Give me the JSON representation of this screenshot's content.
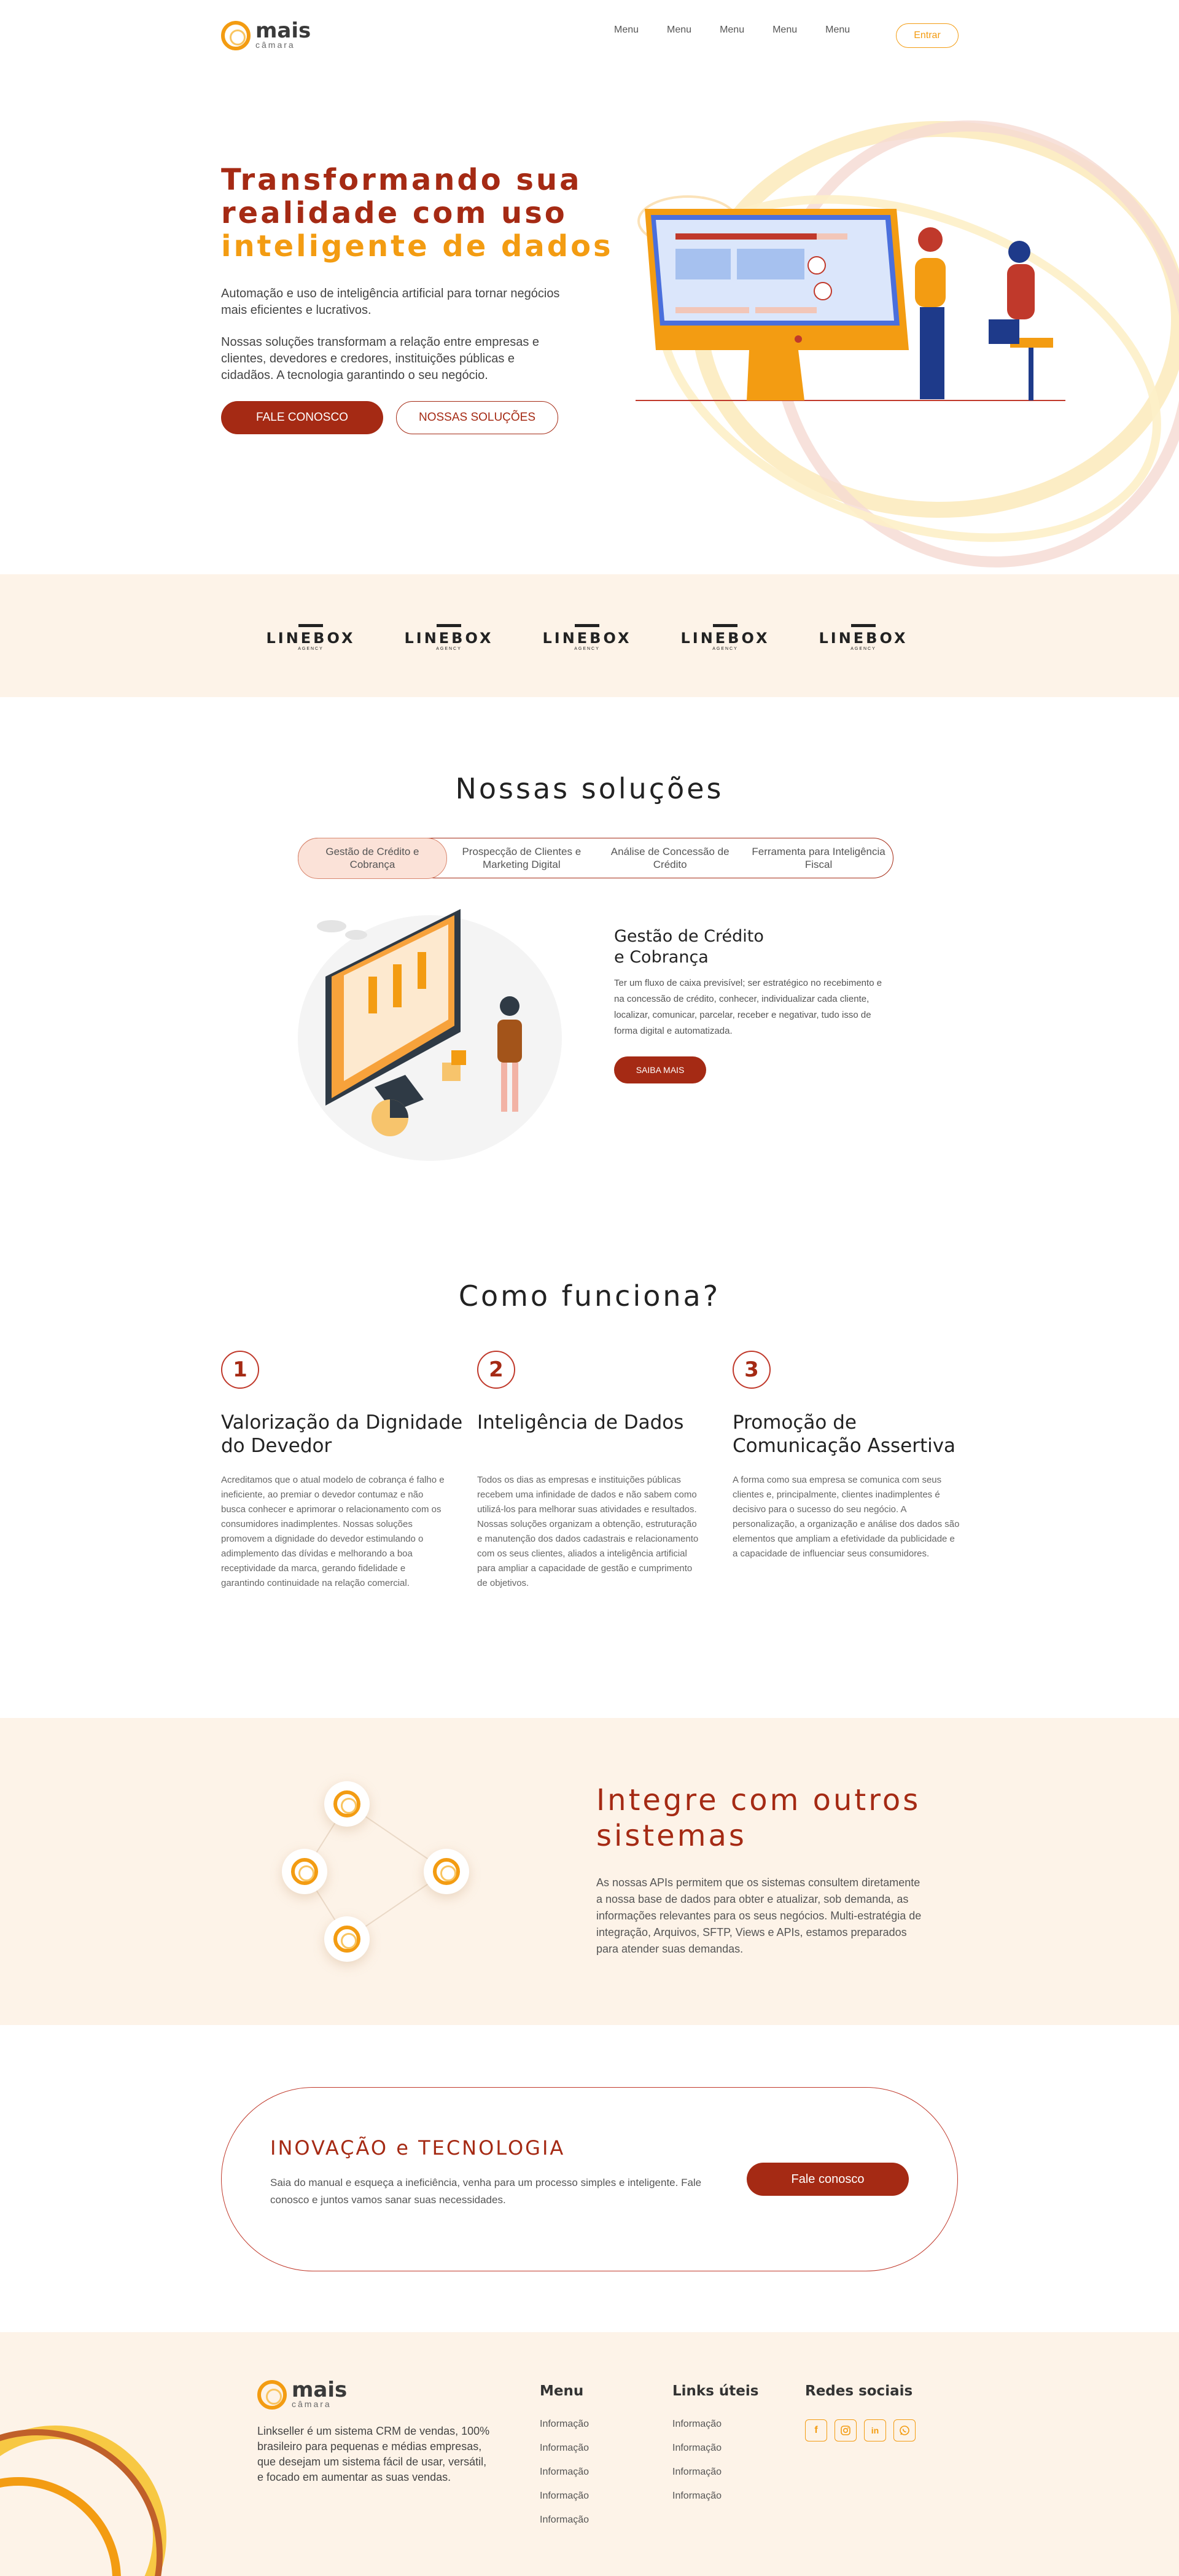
{
  "header": {
    "logo": {
      "brand": "mais",
      "sub": "câmara"
    },
    "nav": [
      "Menu",
      "Menu",
      "Menu",
      "Menu",
      "Menu"
    ],
    "login_label": "Entrar"
  },
  "hero": {
    "title_line1": "Transformando sua",
    "title_line2": "realidade com uso",
    "title_accent": "inteligente de dados",
    "paragraph1": "Automação e uso de inteligência artificial para tornar negócios mais eficientes e lucrativos.",
    "paragraph2": "Nossas soluções transformam a relação entre empresas e clientes, devedores e credores, instituições públicas e cidadãos. A tecnologia garantindo o seu negócio.",
    "primary_label": "FALE CONOSCO",
    "secondary_label": "NOSSAS SOLUÇÕES"
  },
  "partners": [
    {
      "name": "LINEBOX",
      "sub": "AGENCY"
    },
    {
      "name": "LINEBOX",
      "sub": "AGENCY"
    },
    {
      "name": "LINEBOX",
      "sub": "AGENCY"
    },
    {
      "name": "LINEBOX",
      "sub": "AGENCY"
    },
    {
      "name": "LINEBOX",
      "sub": "AGENCY"
    }
  ],
  "solutions": {
    "title": "Nossas soluções",
    "tabs": [
      "Gestão de Crédito e Cobrança",
      "Prospecção de Clientes e Marketing Digital",
      "Análise de Concessão de Crédito",
      "Ferramenta para Inteligência Fiscal"
    ],
    "active_title_line1": "Gestão de Crédito",
    "active_title_line2": "e Cobrança",
    "active_desc": "Ter um fluxo de caixa previsível; ser estratégico no recebimento e na concessão de crédito, conhecer, individualizar cada cliente, localizar, comunicar, parcelar, receber e negativar, tudo isso de forma digital e automatizada.",
    "button_label": "SAIBA MAIS"
  },
  "how": {
    "title": "Como funciona?",
    "steps": [
      {
        "number": "1",
        "title_line1": "Valorização da Dignidade",
        "title_line2": "do Devedor",
        "desc": "Acreditamos que o atual modelo de cobrança é falho e ineficiente, ao premiar o devedor contumaz e não busca conhecer e aprimorar o relacionamento com os consumidores inadimplentes. Nossas soluções promovem a dignidade do devedor estimulando o adimplemento das dívidas e melhorando a boa receptividade da marca, gerando fidelidade e garantindo continuidade na relação comercial."
      },
      {
        "number": "2",
        "title_line1": "Inteligência de Dados",
        "title_line2": "",
        "desc": "Todos os dias as empresas e instituições públicas recebem uma infinidade de dados e não sabem como utilizá-los para melhorar suas atividades e resultados. Nossas soluções organizam a obtenção, estruturação e manutenção dos dados cadastrais e relacionamento com os seus clientes, aliados a inteligência artificial para ampliar a capacidade de gestão e cumprimento de objetivos."
      },
      {
        "number": "3",
        "title_line1": "Promoção de",
        "title_line2": "Comunicação Assertiva",
        "desc": "A forma como sua empresa se comunica com seus clientes e, principalmente, clientes inadimplentes é decisivo para o sucesso do seu negócio. A personalização, a organização e análise dos dados são elementos que ampliam a efetividade da publicidade e a capacidade de influenciar seus consumidores."
      }
    ]
  },
  "integration": {
    "title_line1": "Integre com outros",
    "title_line2": "sistemas",
    "desc": "As nossas APIs permitem que os sistemas consultem diretamente a nossa base de dados para obter e atualizar, sob demanda, as informações relevantes para os seus negócios. Multi-estratégia de integração, Arquivos, SFTP, Views e APIs, estamos preparados para atender suas demandas."
  },
  "cta": {
    "title": "INOVAÇÃO e TECNOLOGIA",
    "text": "Saia do manual e esqueça a ineficiência, venha para um processo simples e inteligente. Fale conosco e juntos vamos sanar suas necessidades.",
    "button_label": "Fale conosco"
  },
  "footer": {
    "logo": {
      "brand": "mais",
      "sub": "câmara"
    },
    "about": "Linkseller é um sistema CRM de vendas, 100% brasileiro para pequenas e médias empresas, que desejam um sistema fácil de usar, versátil, e focado em aumentar as suas vendas.",
    "menu_title": "Menu",
    "menu_links": [
      "Informação",
      "Informação",
      "Informação",
      "Informação",
      "Informação"
    ],
    "links_title": "Links úteis",
    "useful_links": [
      "Informação",
      "Informação",
      "Informação",
      "Informação"
    ],
    "social_title": "Redes sociais",
    "social_icons": [
      "facebook-icon",
      "instagram-icon",
      "linkedin-icon",
      "whatsapp-icon"
    ]
  },
  "colors": {
    "brand_red": "#a52a14",
    "brand_orange": "#f39c12",
    "band_bg": "#fdf3e8"
  }
}
